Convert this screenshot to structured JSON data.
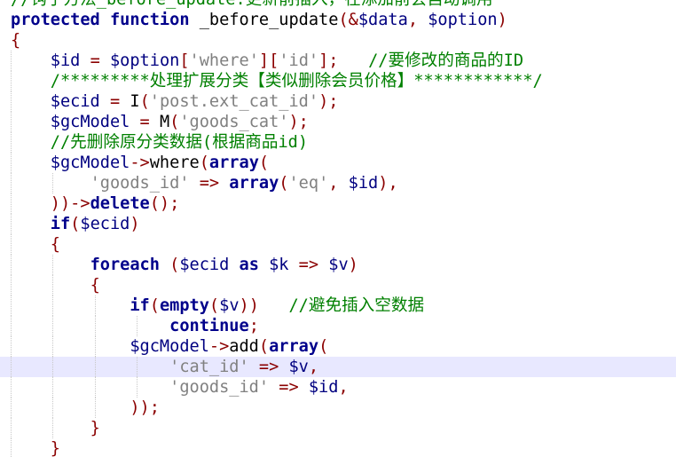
{
  "code": {
    "line0": {
      "comment": "//钩子方法_before_update:更新前插入，在添加前会自动调用"
    },
    "line1": {
      "kw_protected": "protected",
      "kw_function": "function",
      "func_name": " _before_update",
      "open": "(",
      "amp": "&",
      "param1": "$data",
      "comma": ", ",
      "param2": "$option",
      "close": ")"
    },
    "line2": {
      "brace": "{"
    },
    "line3": {
      "var": "$id",
      "eq": " = ",
      "var2": "$option",
      "b1": "[",
      "s1": "'where'",
      "b2": "][",
      "s2": "'id'",
      "b3": "]",
      "semi": ";",
      "comment": "   //要修改的商品的ID"
    },
    "line4": {
      "comment": "/*********处理扩展分类【类似删除会员价格】************/"
    },
    "line5": {
      "var": "$ecid",
      "eq": " = ",
      "fn": "I",
      "open": "(",
      "str": "'post.ext_cat_id'",
      "close": ");"
    },
    "line6": {
      "var": "$gcModel",
      "eq": " = ",
      "fn": "M",
      "open": "(",
      "str": "'goods_cat'",
      "close": ");"
    },
    "line7": {
      "comment": "//先删除原分类数据(根据商品id)"
    },
    "line8": {
      "var": "$gcModel",
      "arrow": "->",
      "fn": "where",
      "open": "(",
      "kw": "array",
      "open2": "("
    },
    "line9": {
      "str": "'goods_id'",
      "arrow": " => ",
      "kw": "array",
      "open": "(",
      "s1": "'eq'",
      "comma": ", ",
      "var": "$id",
      "close": "),"
    },
    "line10": {
      "close": "))->",
      "kw": "delete",
      "end": "();"
    },
    "line11": {
      "kw": "if",
      "open": "(",
      "var": "$ecid",
      "close": ")"
    },
    "line12": {
      "brace": "{"
    },
    "line13": {
      "kw": "foreach",
      "open": " (",
      "var": "$ecid",
      "kw_as": " as ",
      "var2": "$k",
      "arrow": " => ",
      "var3": "$v",
      "close": ")"
    },
    "line14": {
      "brace": "{"
    },
    "line15": {
      "kw": "if",
      "open": "(",
      "kw2": "empty",
      "open2": "(",
      "var": "$v",
      "close": "))",
      "comment": "   //避免插入空数据"
    },
    "line16": {
      "kw": "continue",
      "semi": ";"
    },
    "line17": {
      "var": "$gcModel",
      "arrow": "->",
      "fn": "add",
      "open": "(",
      "kw": "array",
      "open2": "("
    },
    "line18": {
      "str": "'cat_id'",
      "arrow": " => ",
      "var": "$v",
      "comma": ","
    },
    "line19": {
      "str": "'goods_id'",
      "arrow": " => ",
      "var": "$id",
      "comma": ","
    },
    "line20": {
      "close": "));"
    },
    "line21": {
      "brace": "}"
    },
    "line22": {
      "brace": "}"
    }
  },
  "colors": {
    "keyword": "#00008b",
    "variable": "#000080",
    "string": "#808080",
    "comment": "#008000",
    "operator": "#8b0000",
    "current_line": "#e8e8ff"
  }
}
